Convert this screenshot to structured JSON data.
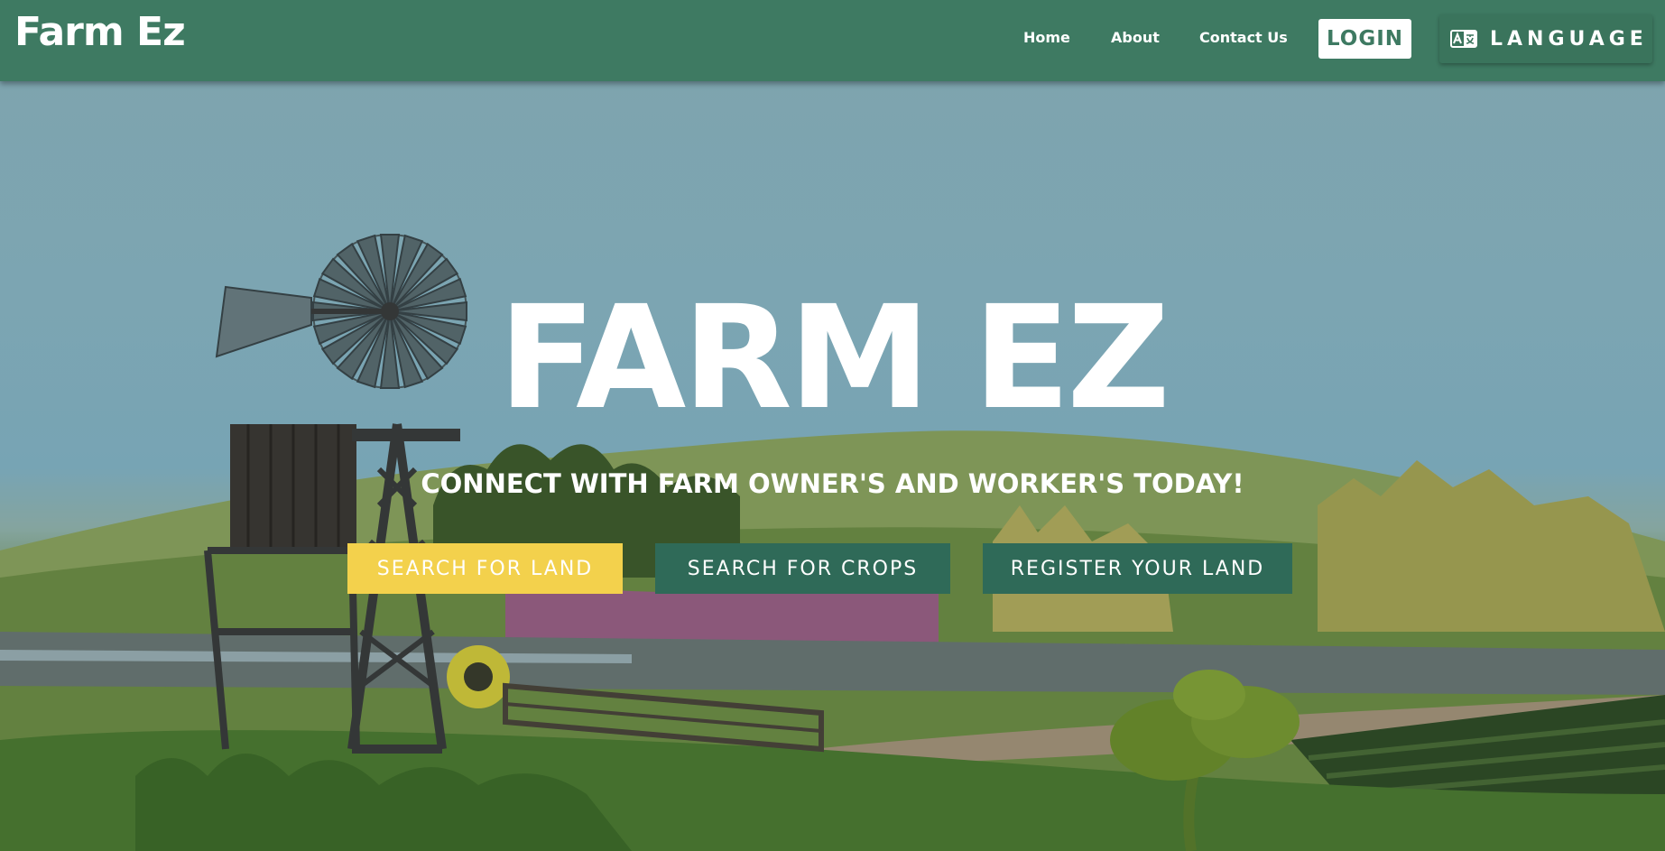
{
  "navbar": {
    "brand": "Farm Ez",
    "links": [
      {
        "label": "Home"
      },
      {
        "label": "About"
      },
      {
        "label": "Contact Us"
      }
    ],
    "login_label": "LOGIN",
    "language_label": "LANGUAGE",
    "language_icon": "translate-icon"
  },
  "hero": {
    "title": "FARM EZ",
    "subtitle": "CONNECT WITH FARM OWNER'S AND WORKER'S TODAY!",
    "buttons": [
      {
        "label": "SEARCH FOR LAND"
      },
      {
        "label": "SEARCH FOR CROPS"
      },
      {
        "label": "REGISTER YOUR LAND"
      }
    ]
  },
  "colors": {
    "navbar": "#3e7a62",
    "primary_button": "#f3d14c",
    "secondary_button": "#2f6a58",
    "text": "#ffffff"
  }
}
